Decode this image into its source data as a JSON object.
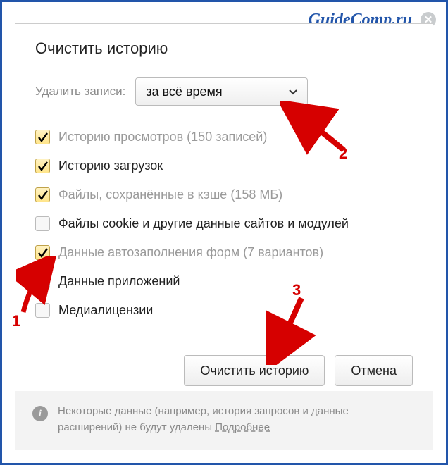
{
  "watermark": "GuideComp.ru",
  "title": "Очистить историю",
  "time_label": "Удалить записи:",
  "dropdown": {
    "selected": "за всё время"
  },
  "options": [
    {
      "label": "Историю просмотров",
      "suffix": "(150 записей)",
      "checked": true,
      "muted": true
    },
    {
      "label": "Историю загрузок",
      "suffix": "",
      "checked": true,
      "muted": false
    },
    {
      "label": "Файлы, сохранённые в кэше",
      "suffix": "(158 МБ)",
      "checked": true,
      "muted": true
    },
    {
      "label": "Файлы cookie и другие данные сайтов и модулей",
      "suffix": "",
      "checked": false,
      "muted": false
    },
    {
      "label": "Данные автозаполнения форм",
      "suffix": "(7 вариантов)",
      "checked": true,
      "muted": true
    },
    {
      "label": "Данные приложений",
      "suffix": "",
      "checked": false,
      "muted": false
    },
    {
      "label": "Медиалицензии",
      "suffix": "",
      "checked": false,
      "muted": false
    }
  ],
  "buttons": {
    "clear": "Очистить историю",
    "cancel": "Отмена"
  },
  "footer": {
    "text": "Некоторые данные (например, история запросов и данные расширений) не будут удалены ",
    "link": "Подробнее"
  },
  "annotations": {
    "n1": "1",
    "n2": "2",
    "n3": "3"
  }
}
